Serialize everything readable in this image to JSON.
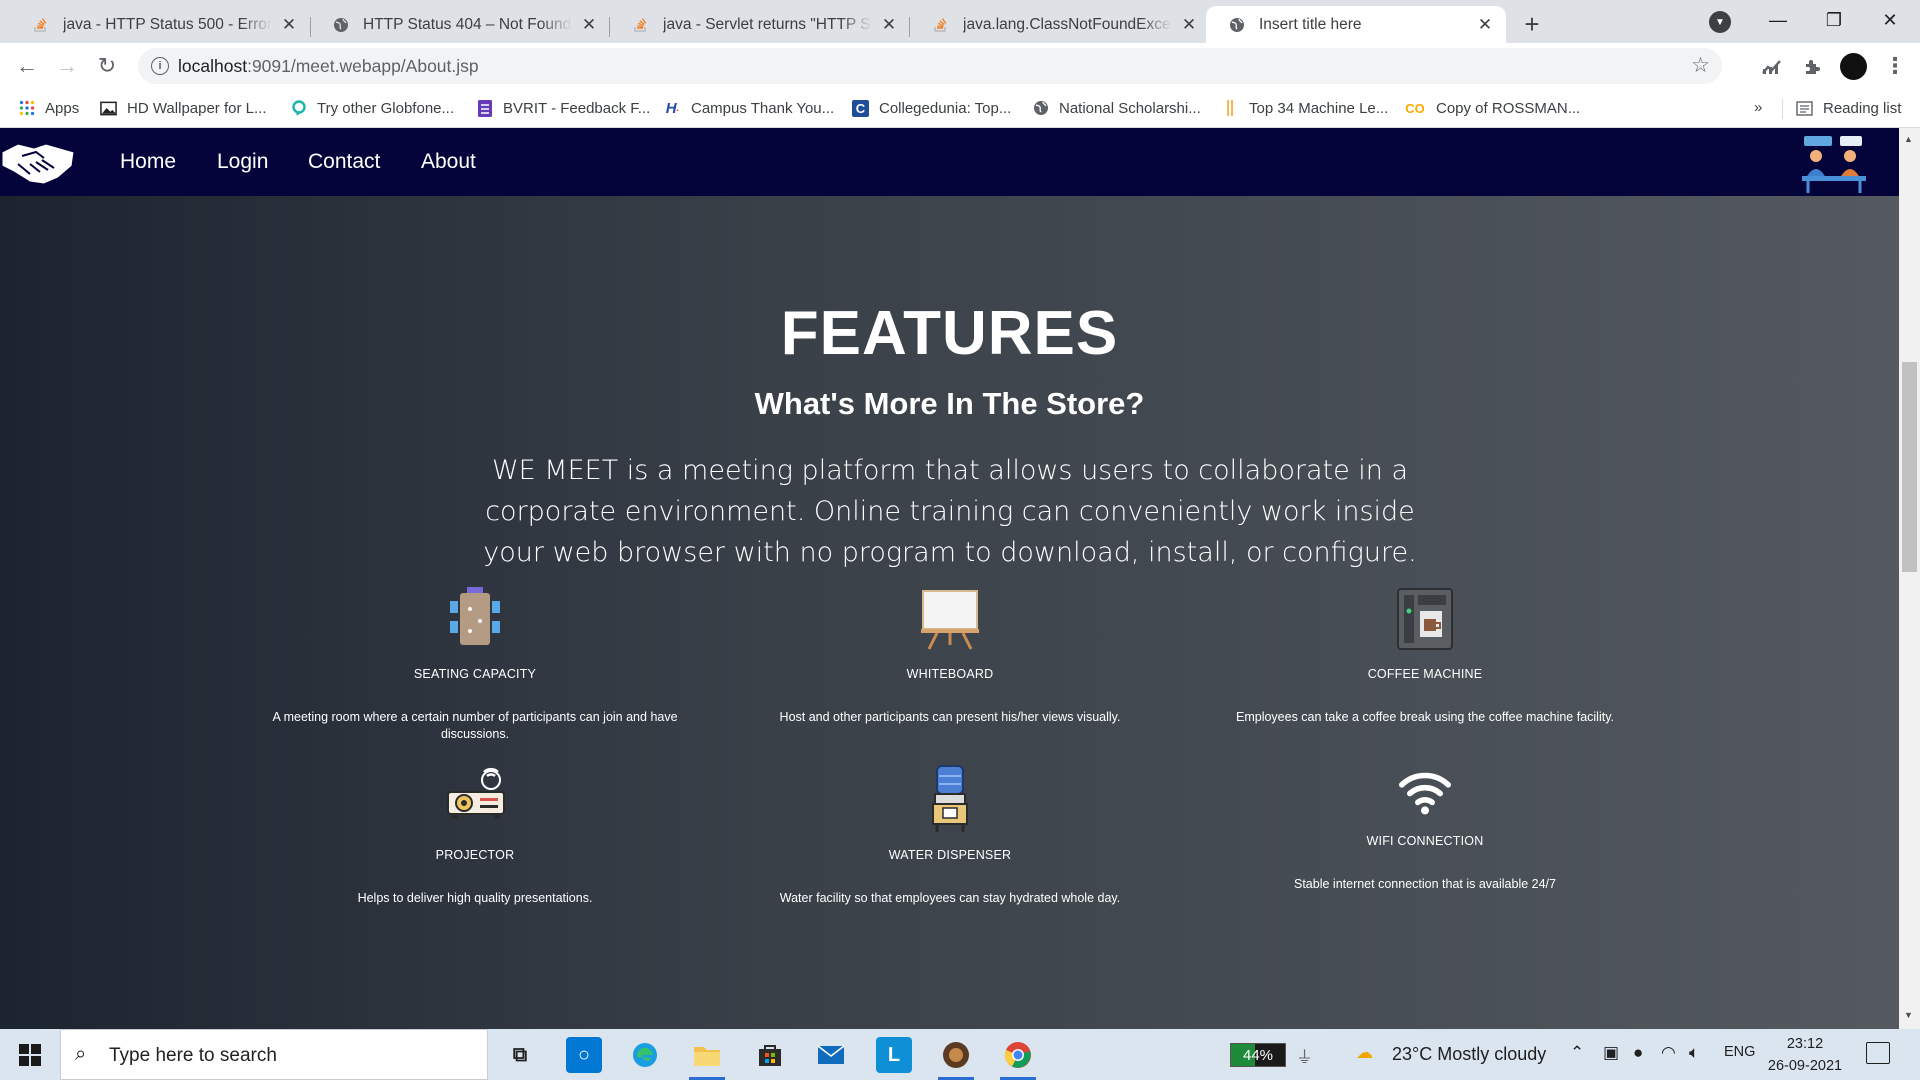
{
  "browser": {
    "tabs": [
      {
        "title": "java - HTTP Status 500 - Error ins",
        "icon": "stackoverflow-icon",
        "active": false
      },
      {
        "title": "HTTP Status 404 – Not Found",
        "icon": "globe-icon",
        "active": false
      },
      {
        "title": "java - Servlet returns \"HTTP Statu",
        "icon": "stackoverflow-icon",
        "active": false
      },
      {
        "title": "java.lang.ClassNotFoundExceptio",
        "icon": "stackoverflow-icon",
        "active": false
      },
      {
        "title": "Insert title here",
        "icon": "globe-icon",
        "active": true
      }
    ],
    "url_host": "localhost",
    "url_path": ":9091/meet.webapp/About.jsp",
    "bookmarks": [
      {
        "label": "Apps",
        "icon": "apps-grid-icon"
      },
      {
        "label": "HD Wallpaper for L...",
        "icon": "image-icon"
      },
      {
        "label": "Try other Globfone...",
        "icon": "globfone-icon"
      },
      {
        "label": "BVRIT - Feedback F...",
        "icon": "forms-icon"
      },
      {
        "label": "Campus Thank You...",
        "icon": "hackerrank-icon"
      },
      {
        "label": "Collegedunia: Top...",
        "icon": "collegedunia-icon"
      },
      {
        "label": "National Scholarshi...",
        "icon": "globe-icon"
      },
      {
        "label": "Top 34 Machine Le...",
        "icon": "bookmark-icon"
      },
      {
        "label": "Copy of ROSSMAN...",
        "icon": "colab-icon"
      }
    ],
    "bookmarks_more": "»",
    "reading_list": "Reading list"
  },
  "site": {
    "nav_links": [
      "Home",
      "Login",
      "Contact",
      "About"
    ],
    "heading": "FEATURES",
    "subheading": "What's More In The Store?",
    "description": "WE MEET is a meeting platform that allows users to collaborate in a corporate environment. Online training can conveniently work inside your web browser with no program to download, install, or configure.",
    "features": [
      {
        "name": "SEATING CAPACITY",
        "desc": "A meeting room where a certain number of participants can join and have discussions.",
        "icon": "seating-icon"
      },
      {
        "name": "WHITEBOARD",
        "desc": "Host and other participants can present his/her views visually.",
        "icon": "whiteboard-icon"
      },
      {
        "name": "COFFEE MACHINE",
        "desc": "Employees can take a coffee break using the coffee machine facility.",
        "icon": "coffee-machine-icon"
      },
      {
        "name": "PROJECTOR",
        "desc": "Helps to deliver high quality presentations.",
        "icon": "projector-icon"
      },
      {
        "name": "WATER DISPENSER",
        "desc": "Water facility so that employees can stay hydrated whole day.",
        "icon": "water-dispenser-icon"
      },
      {
        "name": "WIFI CONNECTION",
        "desc": "Stable internet connection that is available 24/7",
        "icon": "wifi-icon"
      }
    ],
    "colors": {
      "nav_bg": "#04043a",
      "text": "#ffffff"
    }
  },
  "taskbar": {
    "search_placeholder": "Type here to search",
    "battery": "44%",
    "battery_level": 0.44,
    "weather": "23°C  Mostly cloudy",
    "lang": "ENG",
    "time": "23:12",
    "date": "26-09-2021"
  }
}
